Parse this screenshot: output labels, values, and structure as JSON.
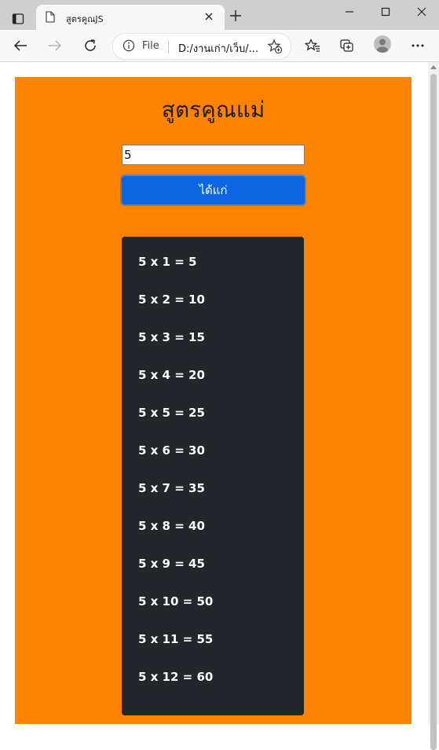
{
  "browser": {
    "tab_title": "สูตรคูณJS",
    "address": {
      "scheme": "File",
      "url": "D:/งานเก่า/เว็บ/..."
    }
  },
  "page": {
    "title": "สูตรคูณแม่",
    "input_value": "5",
    "button_label": "ได้แก่",
    "results": [
      "5 x 1 = 5",
      "5 x 2 = 10",
      "5 x 3 = 15",
      "5 x 4 = 20",
      "5 x 5 = 25",
      "5 x 6 = 30",
      "5 x 7 = 35",
      "5 x 8 = 40",
      "5 x 9 = 45",
      "5 x 10 = 50",
      "5 x 11 = 55",
      "5 x 12 = 60"
    ]
  },
  "colors": {
    "card_background": "#fc8400",
    "button_background": "#0c66e1",
    "result_background": "#23262b"
  }
}
